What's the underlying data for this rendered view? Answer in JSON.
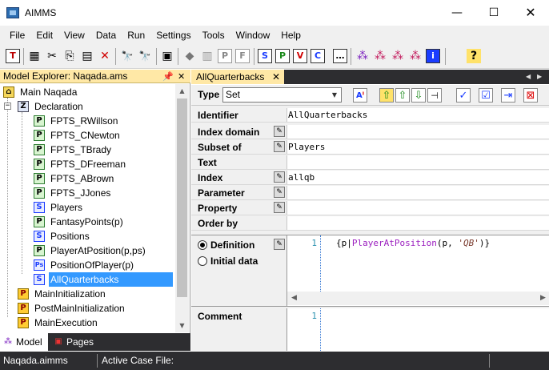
{
  "window": {
    "title": "AIMMS",
    "minimize": "—",
    "maximize": "☐",
    "close": "✕"
  },
  "menu": [
    "File",
    "Edit",
    "View",
    "Data",
    "Run",
    "Settings",
    "Tools",
    "Window",
    "Help"
  ],
  "toolbar": {
    "buttons": [
      "T",
      "▦",
      "✂",
      "⎘",
      "▤",
      "✕",
      "🔭",
      "🔭",
      "▣",
      "◆",
      "▥",
      "P",
      "F",
      "S",
      "P",
      "V",
      "C",
      "…",
      "⁂",
      "⁂",
      "⁂",
      "⁂",
      "i",
      "?"
    ]
  },
  "explorer": {
    "title": "Model Explorer: Naqada.ams",
    "pin": "📌",
    "close": "✕",
    "tree": [
      {
        "label": "Main Naqada",
        "icon": "⌂",
        "kind": "main",
        "level": 0
      },
      {
        "label": "Declaration",
        "icon": "Z",
        "kind": "decl",
        "level": 1
      },
      {
        "label": "FPTS_RWillson",
        "icon": "P",
        "kind": "p",
        "level": 2
      },
      {
        "label": "FPTS_CNewton",
        "icon": "P",
        "kind": "p",
        "level": 2
      },
      {
        "label": "FPTS_TBrady",
        "icon": "P",
        "kind": "p",
        "level": 2
      },
      {
        "label": "FPTS_DFreeman",
        "icon": "P",
        "kind": "p",
        "level": 2
      },
      {
        "label": "FPTS_ABrown",
        "icon": "P",
        "kind": "p",
        "level": 2
      },
      {
        "label": "FPTS_JJones",
        "icon": "P",
        "kind": "p",
        "level": 2
      },
      {
        "label": "Players",
        "icon": "S",
        "kind": "s",
        "level": 2
      },
      {
        "label": "FantasyPoints(p)",
        "icon": "P",
        "kind": "p",
        "level": 2
      },
      {
        "label": "Positions",
        "icon": "S",
        "kind": "s",
        "level": 2
      },
      {
        "label": "PlayerAtPosition(p,ps)",
        "icon": "P",
        "kind": "p",
        "level": 2
      },
      {
        "label": "PositionOfPlayer(p)",
        "icon": "Ps",
        "kind": "s",
        "level": 2
      },
      {
        "label": "AllQuarterbacks",
        "icon": "S",
        "kind": "s",
        "level": 2,
        "selected": true
      },
      {
        "label": "MainInitialization",
        "icon": "P",
        "kind": "proc",
        "level": 1
      },
      {
        "label": "PostMainInitialization",
        "icon": "P",
        "kind": "proc",
        "level": 1
      },
      {
        "label": "MainExecution",
        "icon": "P",
        "kind": "proc",
        "level": 1
      }
    ],
    "tabs": {
      "model": "Model",
      "pages": "Pages"
    }
  },
  "editor": {
    "tab_label": "AllQuarterbacks",
    "tab_close": "✕",
    "type_label": "Type",
    "type_value": "Set",
    "attributes": [
      {
        "label": "Identifier",
        "value": "AllQuarterbacks",
        "wizard": false
      },
      {
        "label": "Index domain",
        "value": "",
        "wizard": true
      },
      {
        "label": "Subset of",
        "value": "Players",
        "wizard": true
      },
      {
        "label": "Text",
        "value": "",
        "wizard": false
      },
      {
        "label": "Index",
        "value": "allqb",
        "wizard": true
      },
      {
        "label": "Parameter",
        "value": "",
        "wizard": true
      },
      {
        "label": "Property",
        "value": "",
        "wizard": true
      },
      {
        "label": "Order by",
        "value": "",
        "wizard": false
      }
    ],
    "definition": {
      "label": "Definition",
      "alt_label": "Initial data",
      "line_number": "1",
      "code": {
        "open": "{p|",
        "ident": "PlayerAtPosition",
        "mid": "(p, ",
        "str": "'QB'",
        "close": ")}"
      }
    },
    "comment": {
      "label": "Comment",
      "line_number": "1"
    }
  },
  "status": {
    "project": "Naqada.aimms",
    "case_label": "Active Case File:"
  }
}
